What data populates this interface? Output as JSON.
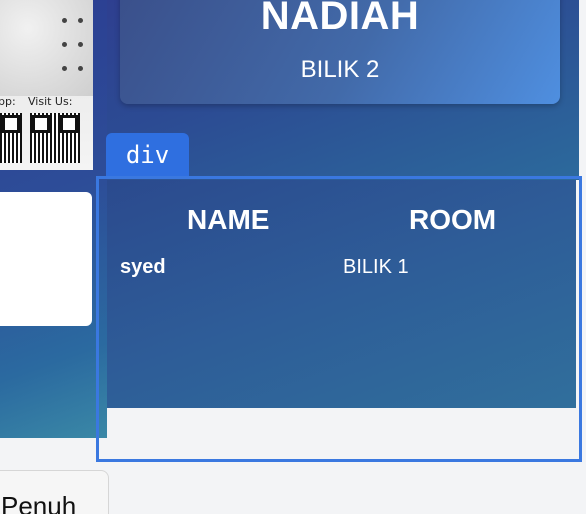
{
  "poster": {
    "app_text": "pp:",
    "visit_text": "Visit Us:"
  },
  "room_card": {
    "name": "NADIAH",
    "room": "BILIK 2"
  },
  "devtools": {
    "badge": "div"
  },
  "table": {
    "headers": [
      "NAME",
      "ROOM"
    ],
    "rows": [
      {
        "name": "syed",
        "room": "BILIK 1"
      }
    ]
  },
  "footer": {
    "button_label": "Penuh"
  }
}
